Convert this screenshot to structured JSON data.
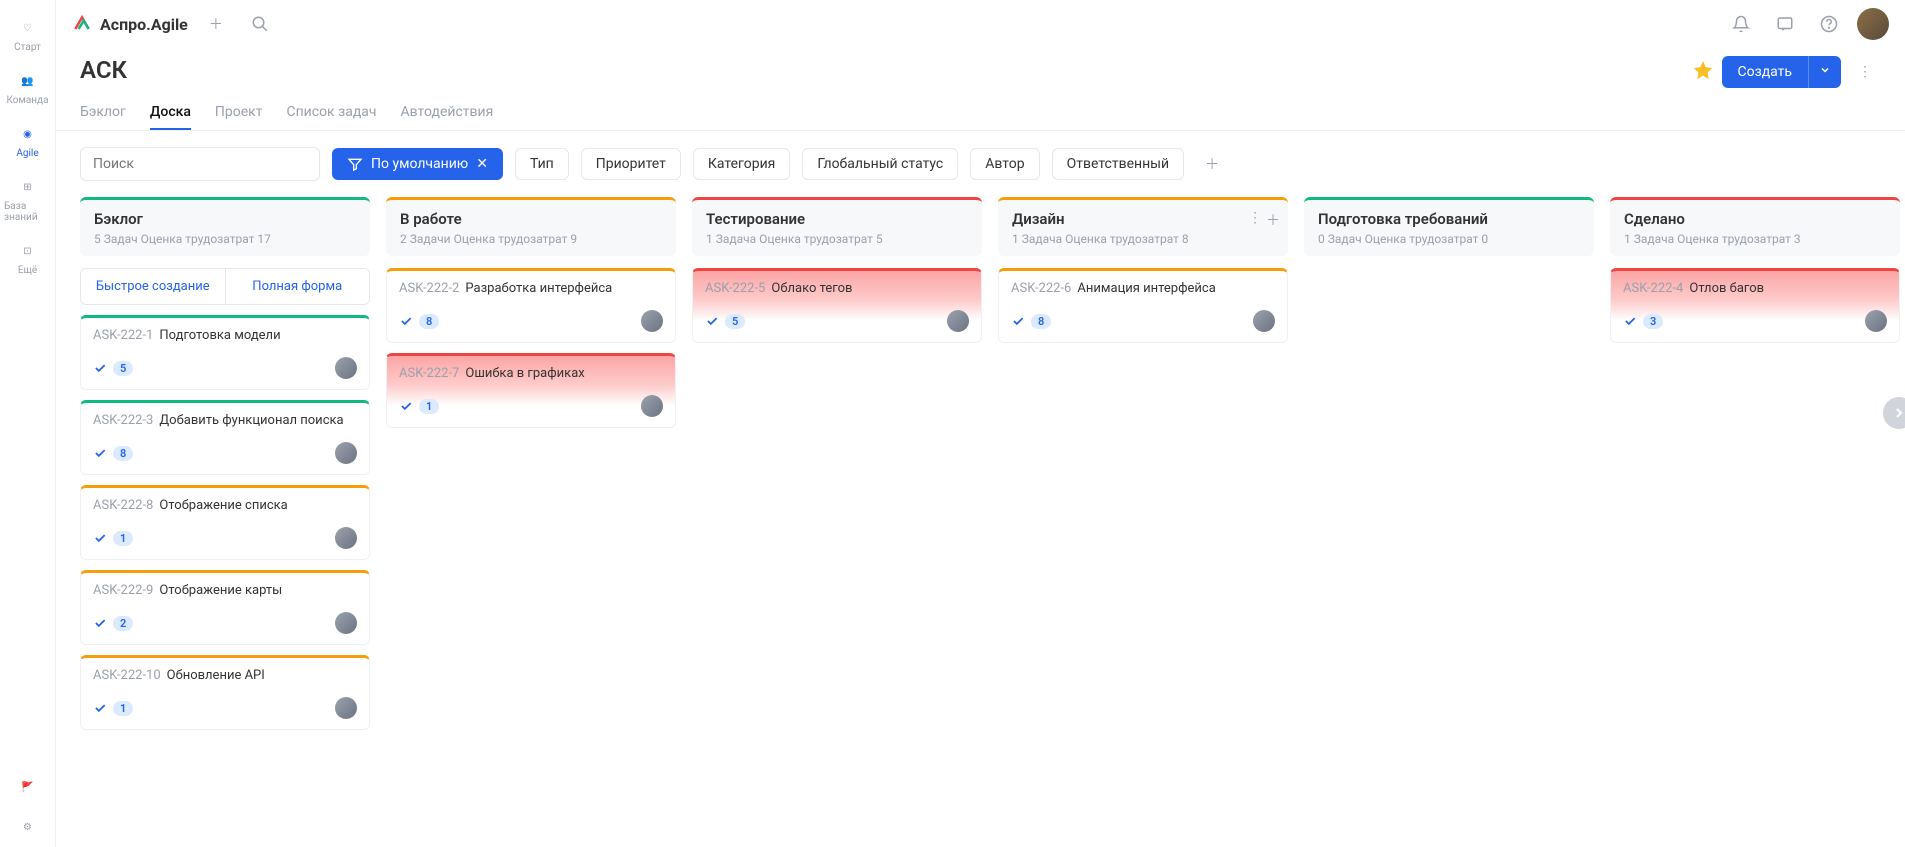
{
  "app_name": "Аспро.Agile",
  "sidebar": {
    "items": [
      {
        "label": "Старт",
        "icon": "heart"
      },
      {
        "label": "Команда",
        "icon": "team"
      },
      {
        "label": "Agile",
        "icon": "agile",
        "active": true
      },
      {
        "label": "База знаний",
        "icon": "kb"
      },
      {
        "label": "Ещё",
        "icon": "grid"
      }
    ]
  },
  "page": {
    "title": "АСК",
    "create": "Создать"
  },
  "tabs": [
    "Бэклог",
    "Доска",
    "Проект",
    "Список задач",
    "Автодействия"
  ],
  "active_tab": 1,
  "search_placeholder": "Поиск",
  "primary_filter": "По умолчанию",
  "filters": [
    "Тип",
    "Приоритет",
    "Категория",
    "Глобальный статус",
    "Автор",
    "Ответственный"
  ],
  "quick_create": {
    "fast": "Быстрое создание",
    "full": "Полная форма"
  },
  "columns": [
    {
      "title": "Бэклог",
      "color": "#10b981",
      "sub": "5 Задач   Оценка трудозатрат 17",
      "quick_create": true,
      "cards": [
        {
          "id": "ASK-222-1",
          "title": "Подготовка модели",
          "points": 5,
          "color": "#10b981"
        },
        {
          "id": "ASK-222-3",
          "title": "Добавить функционал поиска",
          "points": 8,
          "color": "#10b981"
        },
        {
          "id": "ASK-222-8",
          "title": "Отображение списка",
          "points": 1,
          "color": "#f59e0b"
        },
        {
          "id": "ASK-222-9",
          "title": "Отображение карты",
          "points": 2,
          "color": "#f59e0b"
        },
        {
          "id": "ASK-222-10",
          "title": "Обновление API",
          "points": 1,
          "color": "#f59e0b"
        }
      ]
    },
    {
      "title": "В работе",
      "color": "#f59e0b",
      "sub": "2 Задачи   Оценка трудозатрат 9",
      "cards": [
        {
          "id": "ASK-222-2",
          "title": "Разработка интерфейса",
          "points": 8,
          "color": "#f59e0b"
        },
        {
          "id": "ASK-222-7",
          "title": "Ошибка в графиках",
          "points": 1,
          "color": "#ef4444",
          "red": true
        }
      ]
    },
    {
      "title": "Тестирование",
      "color": "#ef4444",
      "sub": "1 Задача   Оценка трудозатрат 5",
      "cards": [
        {
          "id": "ASK-222-5",
          "title": "Облако тегов",
          "points": 5,
          "color": "#ef4444",
          "red": true
        }
      ]
    },
    {
      "title": "Дизайн",
      "color": "#f59e0b",
      "sub": "1 Задача   Оценка трудозатрат 8",
      "hover_actions": true,
      "cards": [
        {
          "id": "ASK-222-6",
          "title": "Анимация интерфейса",
          "points": 8,
          "color": "#f59e0b"
        }
      ]
    },
    {
      "title": "Подготовка требований",
      "color": "#10b981",
      "sub": "0 Задач   Оценка трудозатрат 0",
      "cards": []
    },
    {
      "title": "Сделано",
      "color": "#ef4444",
      "sub": "1 Задача   Оценка трудозатрат 3",
      "cards": [
        {
          "id": "ASK-222-4",
          "title": "Отлов багов",
          "points": 3,
          "color": "#ef4444",
          "red": true
        }
      ]
    }
  ]
}
